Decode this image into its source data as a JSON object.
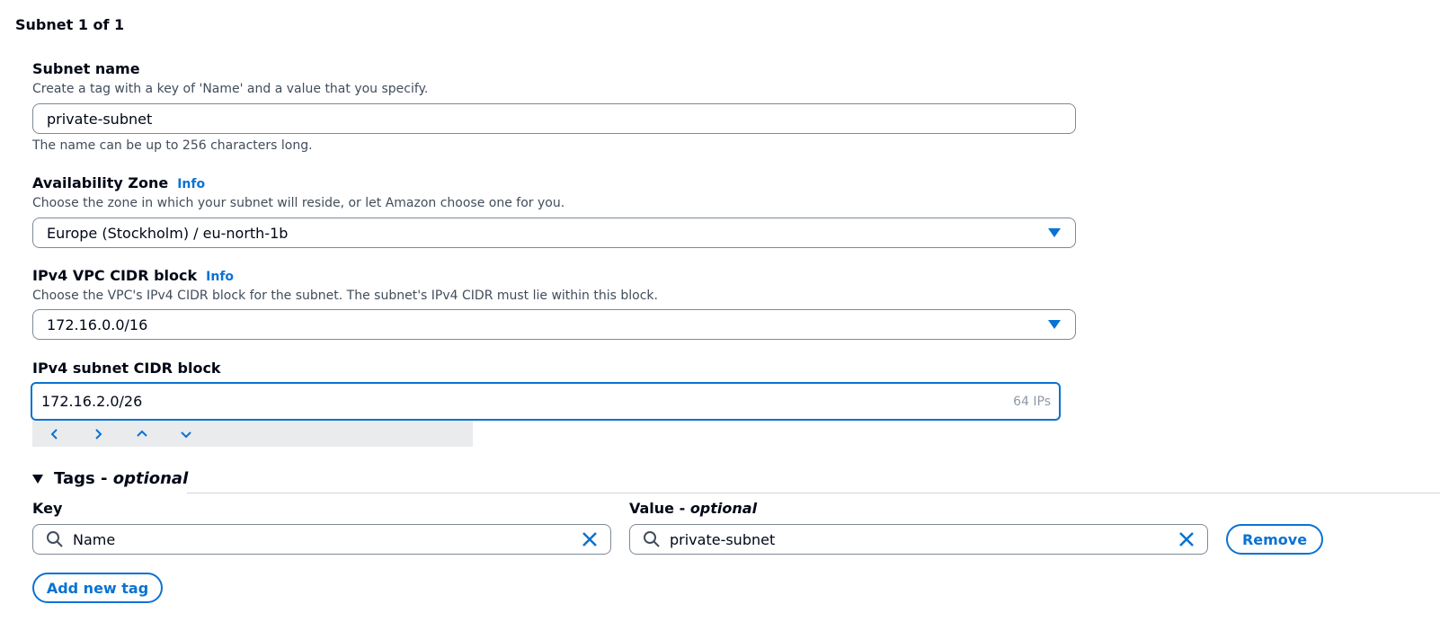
{
  "section": {
    "title": "Subnet 1 of 1"
  },
  "subnet_name": {
    "label": "Subnet name",
    "description": "Create a tag with a key of 'Name' and a value that you specify.",
    "value": "private-subnet",
    "constraint": "The name can be up to 256 characters long."
  },
  "availability_zone": {
    "label": "Availability Zone",
    "info": "Info",
    "description": "Choose the zone in which your subnet will reside, or let Amazon choose one for you.",
    "selected": "Europe (Stockholm) / eu-north-1b"
  },
  "vpc_cidr": {
    "label": "IPv4 VPC CIDR block",
    "info": "Info",
    "description": "Choose the VPC's IPv4 CIDR block for the subnet. The subnet's IPv4 CIDR must lie within this block.",
    "selected": "172.16.0.0/16"
  },
  "subnet_cidr": {
    "label": "IPv4 subnet CIDR block",
    "value": "172.16.2.0/26",
    "ip_count": "64 IPs",
    "stepper_icons": [
      "chevron-left-icon",
      "chevron-right-icon",
      "chevron-up-icon",
      "chevron-down-icon"
    ]
  },
  "tags": {
    "title": "Tags - ",
    "title_optional": "optional",
    "key_label": "Key",
    "value_label": "Value - ",
    "value_optional": "optional",
    "key_value": "Name",
    "value_value": "private-subnet",
    "remove_label": "Remove",
    "add_label": "Add new tag"
  },
  "colors": {
    "accent": "#0972d3",
    "text": "#000716",
    "muted": "#414d5c",
    "border": "#7d8998"
  }
}
